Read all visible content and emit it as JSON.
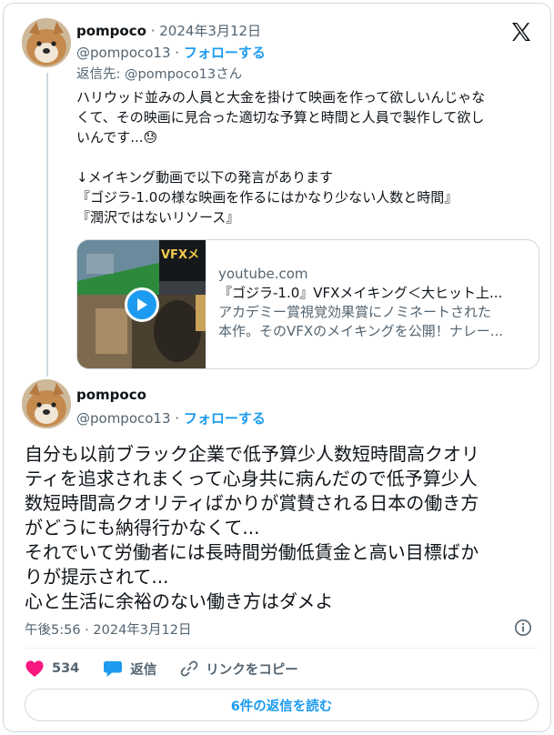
{
  "tweet1": {
    "display_name": "pompoco",
    "separator": " · ",
    "date": "2024年3月12日",
    "handle": "@pompoco13",
    "handle_sep": " · ",
    "follow_label": "フォローする",
    "reply_to": "返信先: @pompoco13さん",
    "lines": [
      "ハリウッド並みの人員と大金を掛けて映画を作って欲しいんじゃな",
      "くて、その映画に見合った適切な予算と時間と人員で製作して欲し",
      "いんです...😓",
      "",
      "↓メイキング動画で以下の発言があります",
      "『ゴジラ-1.0の様な映画を作るにはかなり少ない人数と時間』",
      "『潤沢ではないリソース』"
    ]
  },
  "link_card": {
    "domain": "youtube.com",
    "title": "『ゴジラ-1.0』VFXメイキング＜大ヒット上...",
    "desc_line1": "アカデミー賞視覚効果賞にノミネートされた",
    "desc_line2": "本作。そのVFXのメイキングを公開！ナレー...",
    "thumb_overlay_text": "VFXメ"
  },
  "tweet2": {
    "display_name": "pompoco",
    "handle": "@pompoco13",
    "handle_sep": " · ",
    "follow_label": "フォローする",
    "lines": [
      "自分も以前ブラック企業で低予算少人数短時間高クオリ",
      "ティを追求されまくって心身共に病んだので低予算少人",
      "数短時間高クオリティばかりが賞賛される日本の働き方",
      "がどうにも納得行かなくて...",
      "それでいて労働者には長時間労働低賃金と高い目標ばか",
      "りが提示されて...",
      "心と生活に余裕のない働き方はダメよ"
    ],
    "timestamp": "午後5:56 · 2024年3月12日"
  },
  "actions": {
    "like_count": "534",
    "reply_label": "返信",
    "copy_link_label": "リンクをコピー"
  },
  "read_replies_label": "6件の返信を読む",
  "colors": {
    "accent": "#1d9bf0",
    "like": "#f91880",
    "muted": "#536471",
    "border": "#cfd9de"
  },
  "icons": [
    "x-logo-icon",
    "play-icon",
    "heart-icon",
    "reply-bubble-icon",
    "link-icon",
    "info-icon"
  ]
}
